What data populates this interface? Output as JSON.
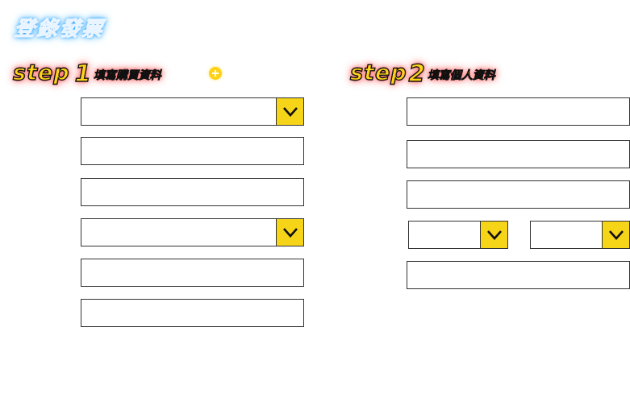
{
  "title": "登錄發票",
  "step1": {
    "word": "step",
    "number": "1",
    "subtitle": "填寫購買資料"
  },
  "step2": {
    "word": "step",
    "number": "2",
    "subtitle": "填寫個人資料"
  },
  "icons": {
    "add": "plus-circle-icon",
    "dropdown": "chevron-down-icon"
  },
  "colors": {
    "accent_yellow": "#f6d418",
    "title_glow": "#2aa3ff",
    "step_glow": "#ff5252",
    "field_border": "#333333"
  },
  "purchase_form": {
    "fields": [
      {
        "type": "select",
        "value": ""
      },
      {
        "type": "text",
        "value": ""
      },
      {
        "type": "text",
        "value": ""
      },
      {
        "type": "select",
        "value": ""
      },
      {
        "type": "text",
        "value": ""
      },
      {
        "type": "text",
        "value": ""
      }
    ]
  },
  "personal_form": {
    "fields": [
      {
        "type": "text",
        "value": ""
      },
      {
        "type": "text",
        "value": ""
      },
      {
        "type": "text",
        "value": ""
      },
      {
        "type": "select",
        "value": ""
      },
      {
        "type": "select",
        "value": ""
      },
      {
        "type": "text",
        "value": ""
      }
    ]
  }
}
